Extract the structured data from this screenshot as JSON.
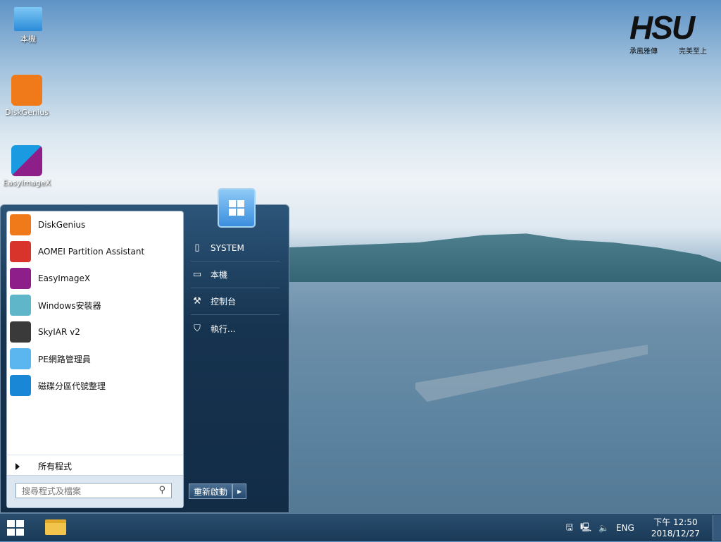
{
  "desktop": {
    "icons": [
      {
        "label": "本機"
      },
      {
        "label": "DiskGenius"
      },
      {
        "label": "EasyImageX"
      }
    ]
  },
  "logo": {
    "text": "HSU",
    "left_motto": "承風雅傳",
    "right_motto": "完美至上"
  },
  "start_menu": {
    "programs": [
      {
        "label": "DiskGenius",
        "color": "#f07a1a"
      },
      {
        "label": "AOMEI Partition Assistant",
        "color": "#d9342b"
      },
      {
        "label": "EasyImageX",
        "color": "#8e1e8a"
      },
      {
        "label": "Windows安裝器",
        "color": "#5fb6c8"
      },
      {
        "label": "SkyIAR v2",
        "color": "#3a3a3a"
      },
      {
        "label": "PE網路管理員",
        "color": "#5bb6f0"
      },
      {
        "label": "磁碟分區代號整理",
        "color": "#1a86d6"
      }
    ],
    "all_programs": "所有程式",
    "search_placeholder": "搜尋程式及檔案",
    "right_items": [
      {
        "label": "SYSTEM"
      },
      {
        "label": "本機"
      },
      {
        "label": "控制台"
      },
      {
        "label": "執行..."
      }
    ],
    "restart_label": "重新啟動"
  },
  "taskbar": {
    "language": "ENG",
    "time": "下午 12:50",
    "date": "2018/12/27"
  }
}
